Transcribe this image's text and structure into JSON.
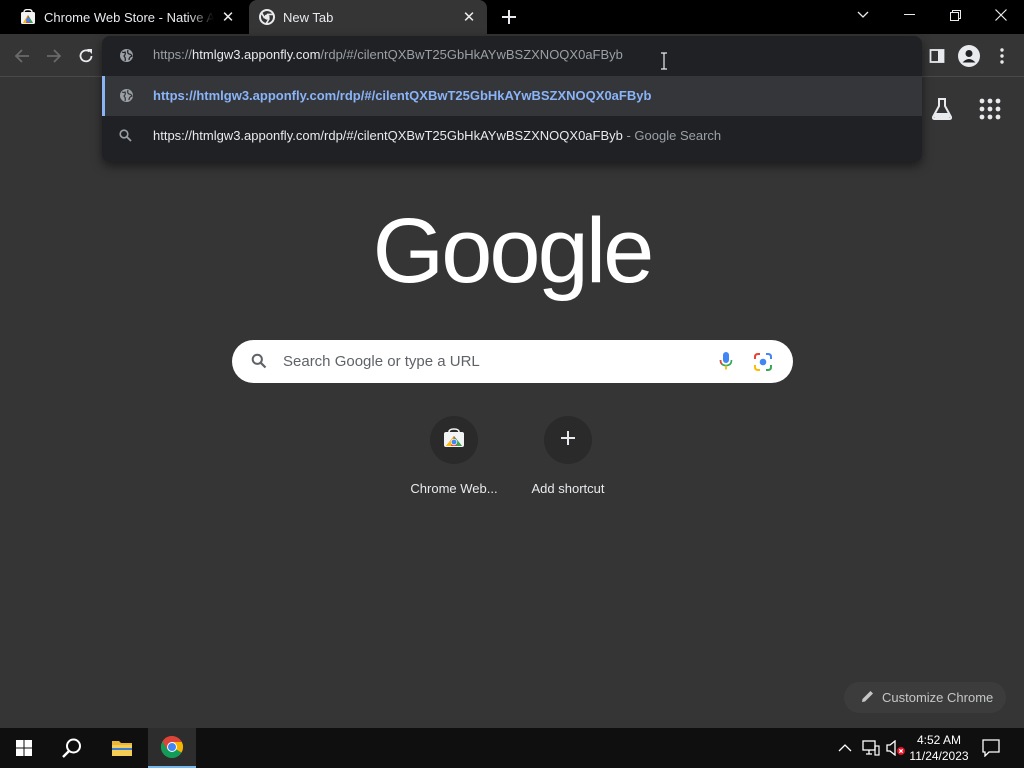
{
  "tabs": [
    {
      "title": "Chrome Web Store - Native Ame",
      "icon": "chrome-web-store-icon"
    },
    {
      "title": "New Tab",
      "icon": "chrome-icon"
    }
  ],
  "omnibox": {
    "prefix": "https://",
    "host": "htmlgw3.apponfly.com",
    "path": "/rdp/#/cilentQXBwT25GbHkAYwBSZXNOQX0aFByb",
    "suggestions": [
      {
        "text": "https://htmlgw3.apponfly.com/rdp/#/cilentQXBwT25GbHkAYwBSZXNOQX0aFByb",
        "suffix": ""
      },
      {
        "text": "https://htmlgw3.apponfly.com/rdp/#/cilentQXBwT25GbHkAYwBSZXNOQX0aFByb",
        "suffix": " - Google Search"
      }
    ]
  },
  "ntp": {
    "logo": "Google",
    "search_placeholder": "Search Google or type a URL",
    "shortcuts": [
      {
        "label": "Chrome Web..."
      },
      {
        "label": "Add shortcut"
      }
    ],
    "customize_label": "Customize Chrome"
  },
  "taskbar": {
    "time": "4:52 AM",
    "date": "11/24/2023"
  },
  "colors": {
    "accent_blue": "#8ab4f8",
    "background": "#353535",
    "omnibox_bg": "#202124"
  }
}
